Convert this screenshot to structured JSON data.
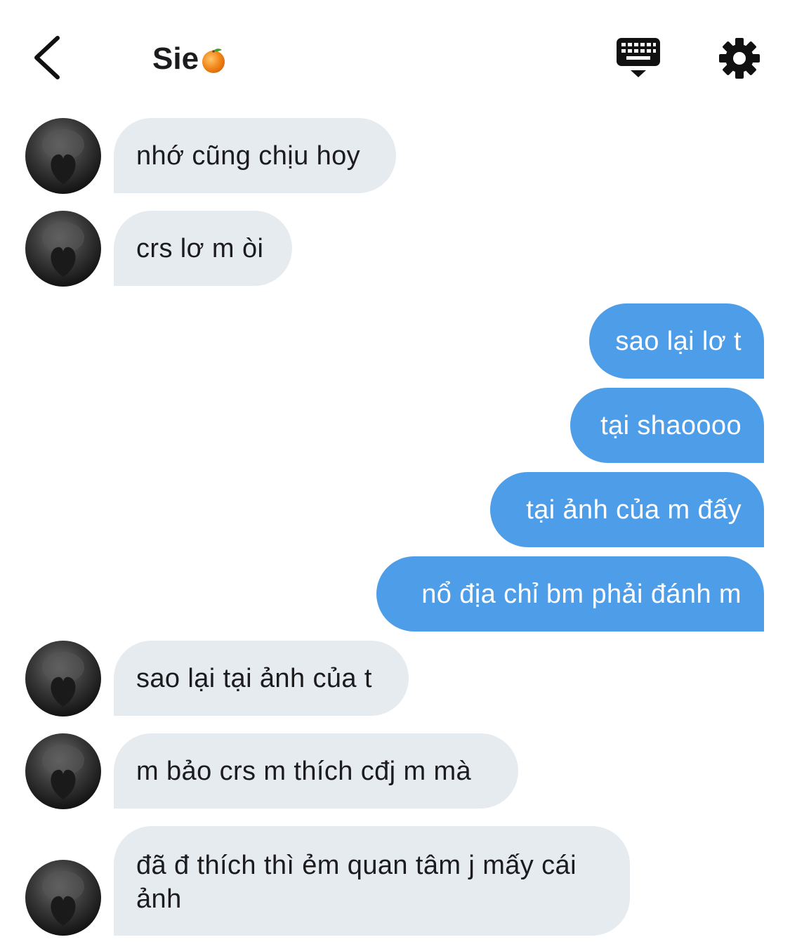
{
  "header": {
    "title": "Sie",
    "back_icon": "chevron-left-icon",
    "keyboard_icon": "keyboard-icon",
    "settings_icon": "gear-icon",
    "title_emoji": "orange-emoji-icon"
  },
  "colors": {
    "incoming_bubble": "#e6ebf0",
    "outgoing_bubble": "#4d9de8",
    "text_dark": "#1c1c1e",
    "text_light": "#ffffff"
  },
  "messages": [
    {
      "direction": "incoming",
      "text": "nhớ cũng chịu hoy"
    },
    {
      "direction": "incoming",
      "text": "crs lơ m òi"
    },
    {
      "direction": "outgoing",
      "text": "sao lại lơ t"
    },
    {
      "direction": "outgoing",
      "text": "tại shaoooo"
    },
    {
      "direction": "outgoing",
      "text": "tại ảnh của m đấy"
    },
    {
      "direction": "outgoing",
      "text": "nổ địa chỉ bm phải đánh m"
    },
    {
      "direction": "incoming",
      "text": "sao lại tại ảnh của t"
    },
    {
      "direction": "incoming",
      "text": "m bảo crs m thích cđj m mà"
    },
    {
      "direction": "incoming",
      "text": "đã đ thích thì ẻm quan tâm j mấy cái ảnh"
    }
  ]
}
